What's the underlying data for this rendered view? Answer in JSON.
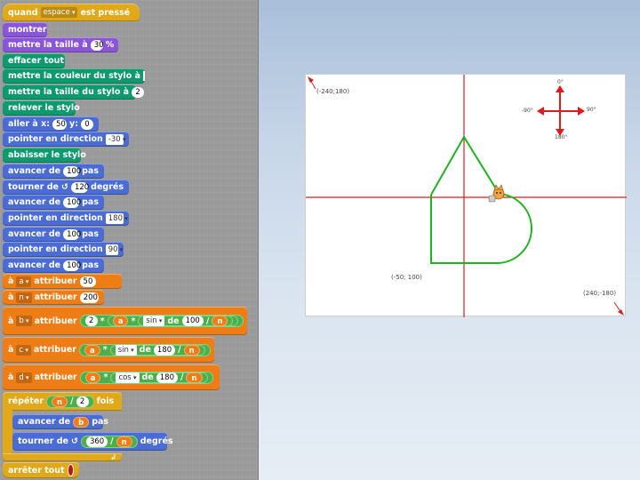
{
  "blocks": {
    "when": "quand",
    "key": "espace",
    "pressed": "est pressé",
    "show": "montrer",
    "size_lbl": "mettre la taille à",
    "size_val": "30",
    "size_unit": "%",
    "clear": "effacer tout",
    "pencolor": "mettre la couleur du stylo à",
    "pensize": "mettre la taille du stylo à",
    "pensize_val": "2",
    "penup": "relever le stylo",
    "goto": "aller à x:",
    "goto_x": "50",
    "goto_ylbl": "y:",
    "goto_y": "0",
    "point": "pointer en direction",
    "dir1": "-30",
    "pendown": "abaisser le stylo",
    "move": "avancer de",
    "steps": "pas",
    "move1": "100",
    "turn": "tourner de",
    "turn_val": "120",
    "degrees": "degrés",
    "move2": "100",
    "dir2": "180",
    "move3": "100",
    "dir3": "90",
    "move4": "100",
    "to": "à",
    "assign": "attribuer",
    "var_a": "a",
    "val_a": "50",
    "var_n": "n",
    "val_n": "200",
    "var_b": "b",
    "two": "2",
    "times": "*",
    "a": "a",
    "sin": "sin",
    "of": "de",
    "hundred": "100",
    "div": "/",
    "n": "n",
    "var_c": "c",
    "v180": "180",
    "var_d": "d",
    "cos": "cos",
    "repeat": "répéter",
    "fois": "fois",
    "inner_move_var": "b",
    "inner_turn": "360",
    "stop": "arrêter tout"
  },
  "stage": {
    "tl": "(-240;180)",
    "c1": "(-50; 100)",
    "br": "(240;-180)",
    "compass_n": "0°",
    "compass_e": "90°",
    "compass_s": "180°",
    "compass_w": "-90°"
  },
  "colors": {
    "pen": "#1db51d",
    "axes": "#e01b1b"
  }
}
